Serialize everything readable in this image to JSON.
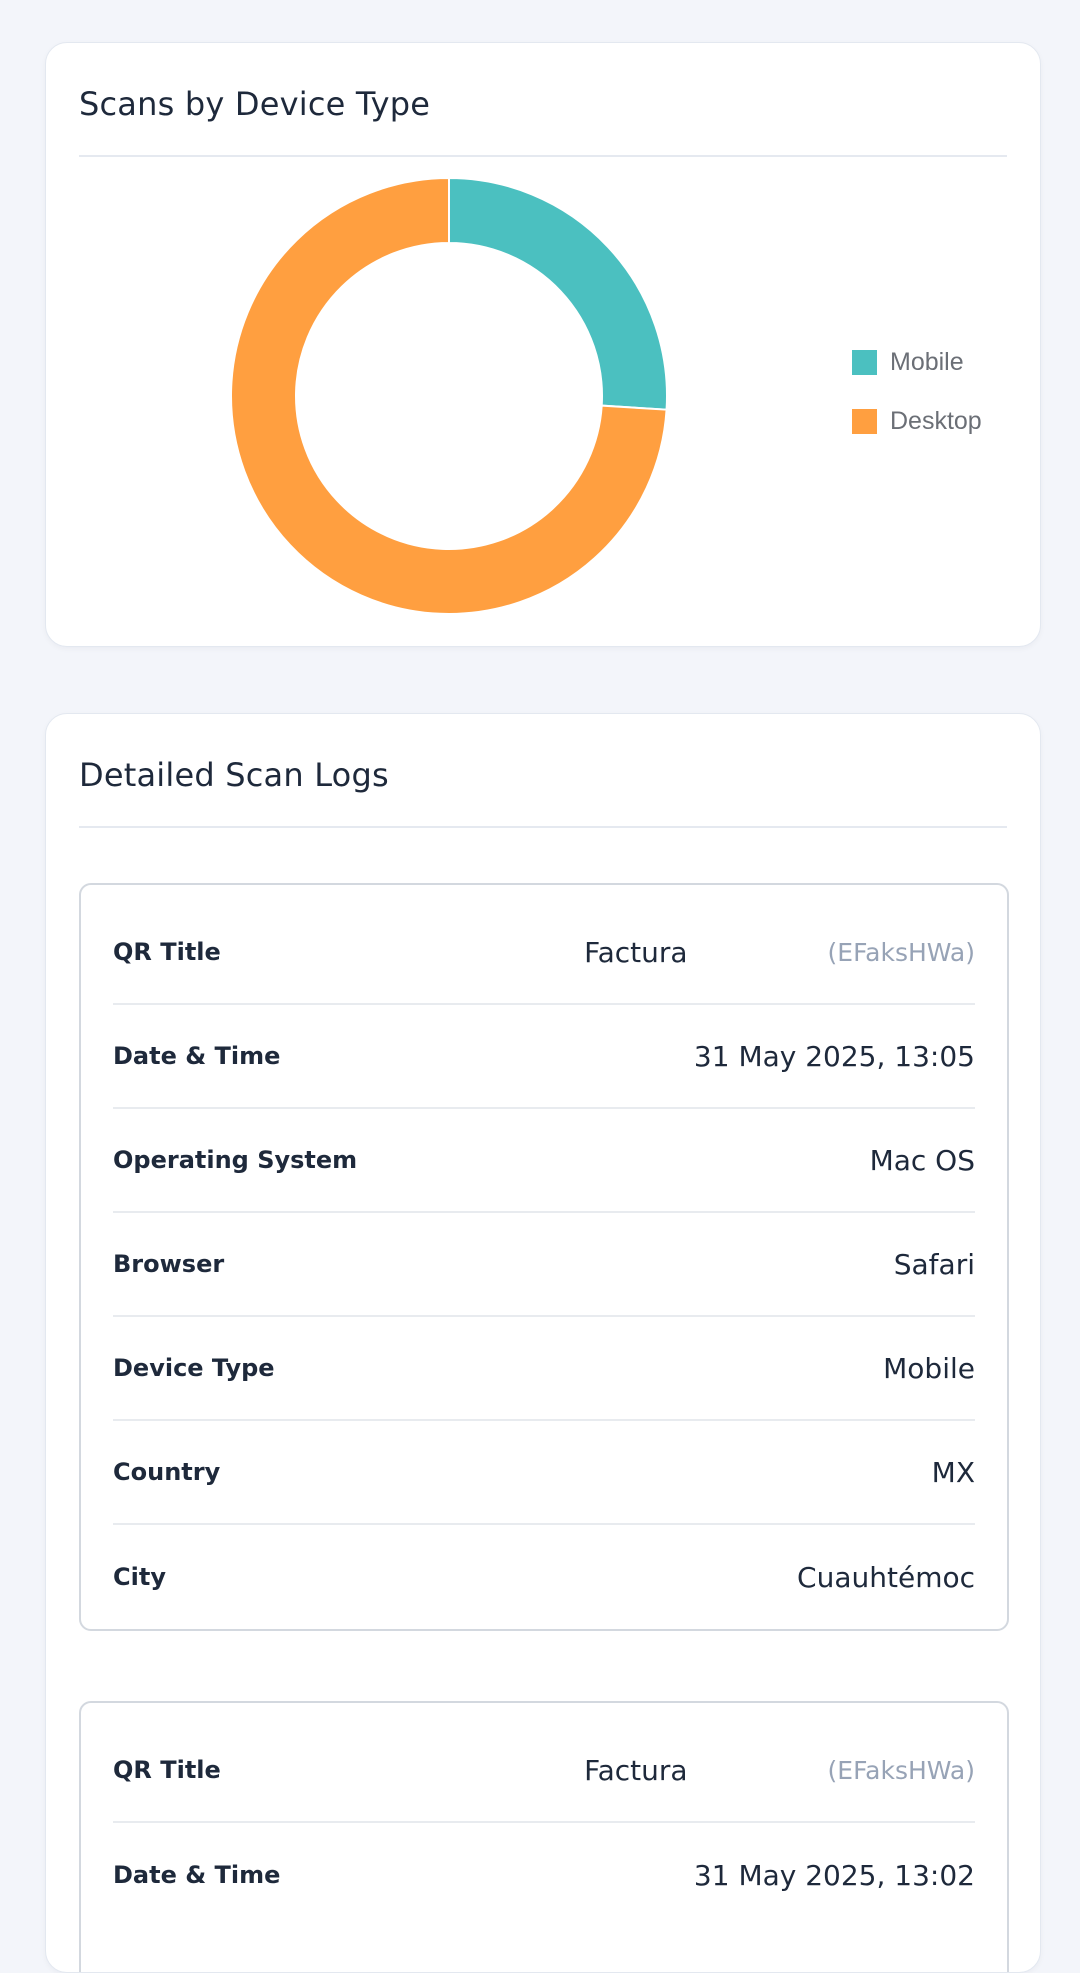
{
  "device_chart": {
    "title": "Scans by Device Type",
    "chart_data": {
      "type": "pie",
      "donut": true,
      "categories": [
        "Mobile",
        "Desktop"
      ],
      "values": [
        26,
        74
      ],
      "colors": [
        "#4bc0c0",
        "#ff9f40"
      ],
      "legend_position": "right"
    }
  },
  "logs": {
    "title": "Detailed Scan Logs",
    "labels": {
      "qr_title": "QR Title",
      "date_time": "Date & Time",
      "os": "Operating System",
      "browser": "Browser",
      "device_type": "Device Type",
      "country": "Country",
      "city": "City"
    },
    "entries": [
      {
        "qr_title": "Factura",
        "qr_code": "(EFaksHWa)",
        "date_time": "31 May 2025, 13:05",
        "os": "Mac OS",
        "browser": "Safari",
        "device_type": "Mobile",
        "country": "MX",
        "city": "Cuauhtémoc"
      },
      {
        "qr_title": "Factura",
        "qr_code": "(EFaksHWa)",
        "date_time": "31 May 2025, 13:02"
      }
    ]
  }
}
